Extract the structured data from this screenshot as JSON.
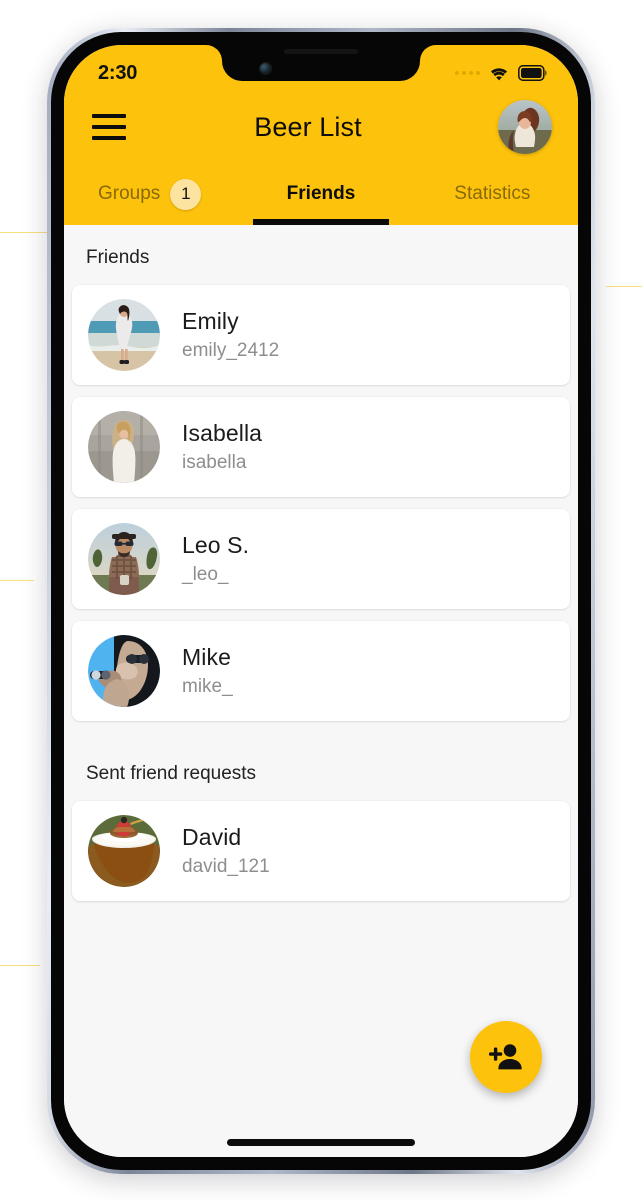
{
  "status_bar": {
    "time": "2:30",
    "signal_icon": "signal-dots-icon",
    "wifi_icon": "wifi-icon",
    "battery_icon": "battery-full-icon"
  },
  "header": {
    "menu_icon": "hamburger-menu-icon",
    "title": "Beer List",
    "avatar_name": "user-avatar"
  },
  "tabs": [
    {
      "label": "Groups",
      "badge": "1",
      "active": false
    },
    {
      "label": "Friends",
      "badge": null,
      "active": true
    },
    {
      "label": "Statistics",
      "badge": null,
      "active": false
    }
  ],
  "sections": [
    {
      "title": "Friends",
      "items": [
        {
          "name": "Emily",
          "username": "emily_2412"
        },
        {
          "name": "Isabella",
          "username": "isabella"
        },
        {
          "name": "Leo S.",
          "username": "_leo_"
        },
        {
          "name": "Mike",
          "username": "mike_"
        }
      ]
    },
    {
      "title": "Sent friend requests",
      "items": [
        {
          "name": "David",
          "username": "david_121"
        }
      ]
    }
  ],
  "fab": {
    "icon": "person-add-icon",
    "label": "Add friend"
  },
  "colors": {
    "accent": "#FDC20B",
    "badge_bg": "#FCE3A0",
    "tab_inactive": "#8A6A07",
    "body_bg": "#F7F7F7",
    "card_bg": "#FFFFFF",
    "name_text": "#1B1B1B",
    "username_text": "#8E8E8E"
  }
}
